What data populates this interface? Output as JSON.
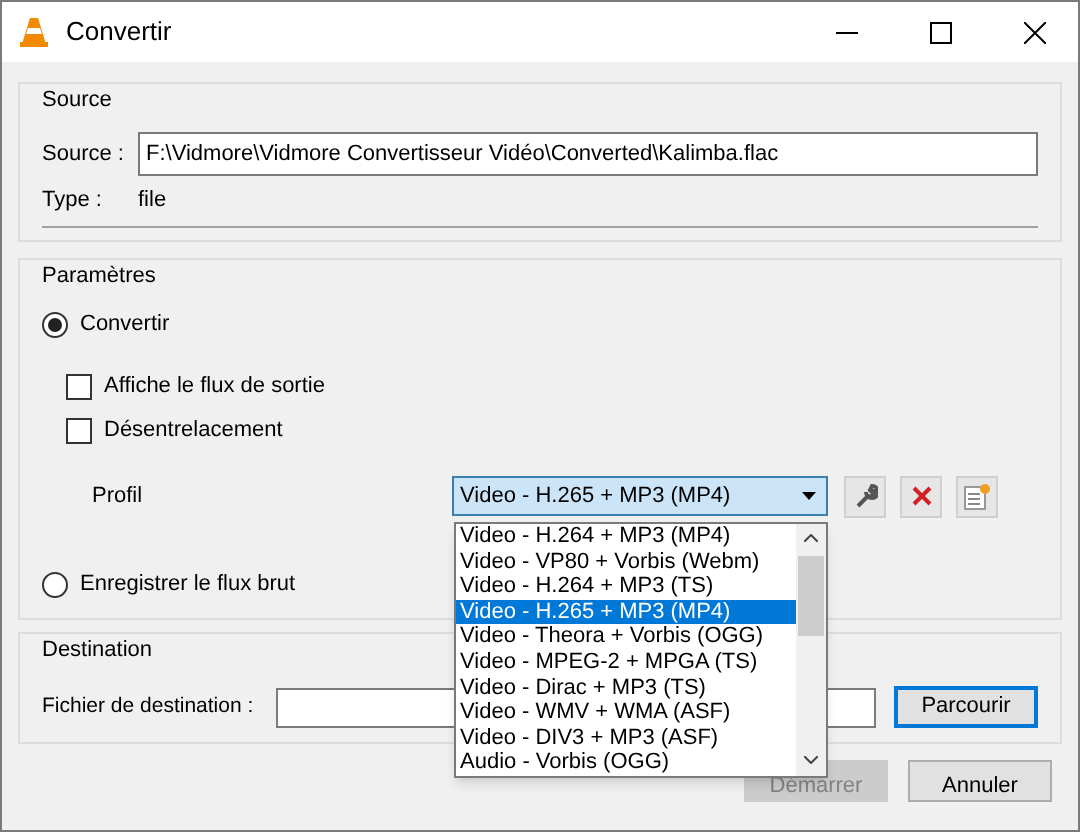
{
  "window": {
    "title": "Convertir"
  },
  "source": {
    "heading": "Source",
    "source_label": "Source :",
    "source_value": "F:\\Vidmore\\Vidmore Convertisseur Vidéo\\Converted\\Kalimba.flac",
    "type_label": "Type :",
    "type_value": "file"
  },
  "parameters": {
    "heading": "Paramètres",
    "modes": [
      {
        "label": "Convertir",
        "selected": true
      },
      {
        "label": "Enregistrer le flux brut",
        "selected": false
      }
    ],
    "options": [
      {
        "label": "Affiche le flux de sortie",
        "checked": false
      },
      {
        "label": "Désentrelacement",
        "checked": false
      }
    ],
    "profile_label": "Profil",
    "profile_value": "Video - H.265 + MP3 (MP4)",
    "profile_list": [
      {
        "label": "Video - H.264 + MP3 (MP4)",
        "selected": false
      },
      {
        "label": "Video - VP80 + Vorbis (Webm)",
        "selected": false
      },
      {
        "label": "Video - H.264 + MP3 (TS)",
        "selected": false
      },
      {
        "label": "Video - H.265 + MP3 (MP4)",
        "selected": true
      },
      {
        "label": "Video - Theora + Vorbis (OGG)",
        "selected": false
      },
      {
        "label": "Video - MPEG-2 + MPGA (TS)",
        "selected": false
      },
      {
        "label": "Video - Dirac + MP3 (TS)",
        "selected": false
      },
      {
        "label": "Video - WMV + WMA (ASF)",
        "selected": false
      },
      {
        "label": "Video - DIV3 + MP3 (ASF)",
        "selected": false
      },
      {
        "label": "Audio - Vorbis (OGG)",
        "selected": false
      }
    ]
  },
  "destination": {
    "heading": "Destination",
    "file_label": "Fichier de destination :",
    "browse_button": "Parcourir"
  },
  "buttons": [
    {
      "label": "Démarrer",
      "disabled": true
    },
    {
      "label": "Annuler",
      "disabled": false
    }
  ]
}
